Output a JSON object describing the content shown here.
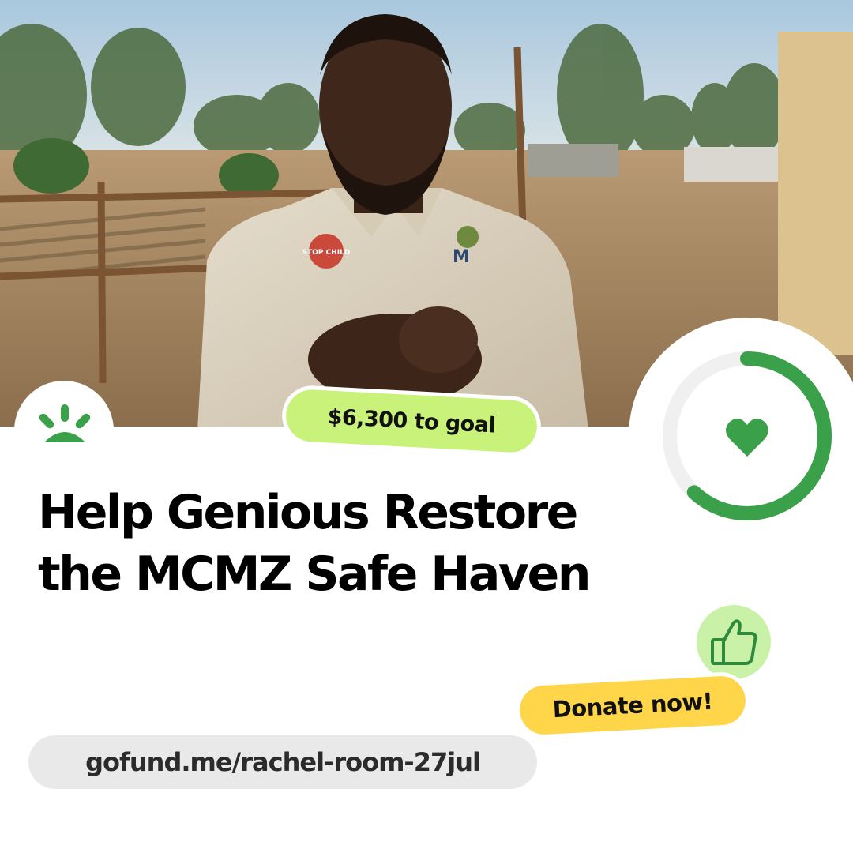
{
  "campaign": {
    "goal_remaining": "$6,300 to goal",
    "title_line1": "Help Genious Restore",
    "title_line2": "the MCMZ Safe Haven",
    "progress_fraction": 0.62
  },
  "actions": {
    "donate_label": "Donate now!"
  },
  "footer": {
    "url": "gofund.me/rachel-room-27jul"
  },
  "photo": {
    "shirt_badge_1": "STOP CHILD",
    "shirt_badge_2": "M"
  },
  "colors": {
    "brand_green": "#3aa04a",
    "ring_track": "#f0f0f0",
    "goal_pill": "#c9f27a",
    "donate": "#ffd54a",
    "thumb_bg": "#c9f2a8",
    "url_pill": "#e9e9e9"
  },
  "icons": {
    "logo": "gofundme-sun-icon",
    "ring_center": "heart-icon",
    "badge": "thumbs-up-icon"
  }
}
